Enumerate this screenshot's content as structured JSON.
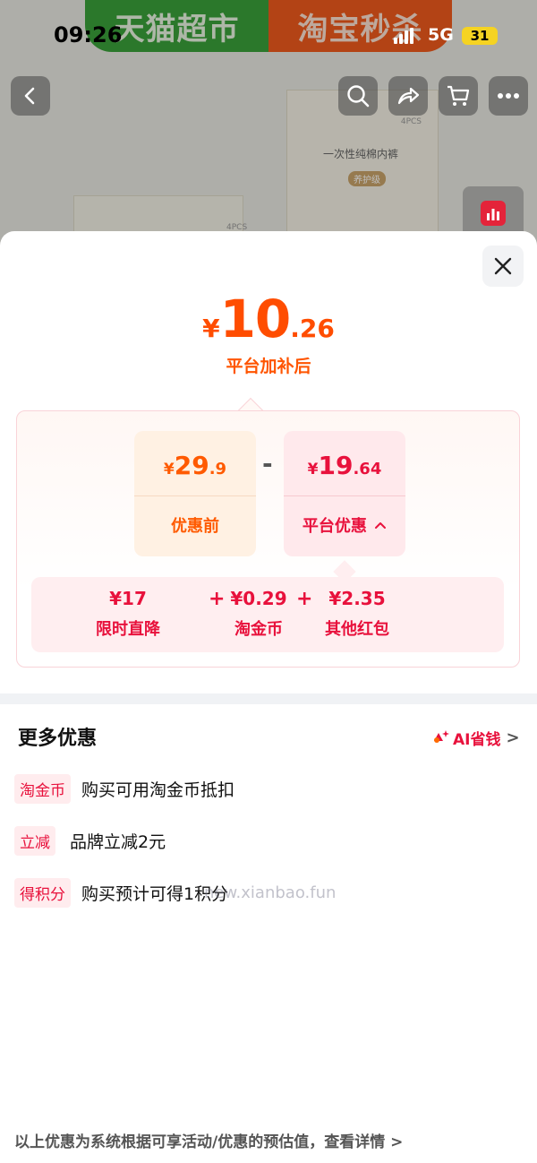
{
  "status_bar": {
    "time": "09:26",
    "network": "5G",
    "battery": "31"
  },
  "background": {
    "banner_left": "天猫超市",
    "banner_right": "淘宝秒杀",
    "product_text": "一次性纯棉内裤",
    "product_tag": "养护级",
    "pcs_label": "4PCS"
  },
  "nav": {
    "back_icon": "chevron-left-icon",
    "search_icon": "search-icon",
    "share_icon": "share-icon",
    "cart_icon": "cart-icon",
    "more_icon": "more-dots-icon"
  },
  "sheet": {
    "final_price": {
      "currency": "¥",
      "integer": "10",
      "decimal": ".26",
      "caption": "平台加补后"
    },
    "before": {
      "currency": "¥",
      "integer": "29",
      "decimal": ".9",
      "label": "优惠前"
    },
    "operator": "-",
    "platform": {
      "currency": "¥",
      "integer": "19",
      "decimal": ".64",
      "label": "平台优惠",
      "chevron": "^"
    },
    "sub_discounts": [
      {
        "value": "¥17",
        "label": "限时直降"
      },
      {
        "value": "¥0.29",
        "label": "淘金币"
      },
      {
        "value": "¥2.35",
        "label": "其他红包"
      }
    ],
    "plus_symbol": "+",
    "more_section": {
      "title": "更多优惠",
      "ai_link_label": "AI省钱",
      "ai_link_chevron": ">"
    },
    "promos": [
      {
        "tag": "淘金币",
        "text": "购买可用淘金币抵扣"
      },
      {
        "tag": "立减",
        "text": "品牌立减2元"
      },
      {
        "tag": "得积分",
        "text": "购买预计可得1积分"
      }
    ],
    "footer_note": "以上优惠为系统根据可享活动/优惠的预估值，查看详情 >",
    "watermark": "new.xianbao.fun"
  },
  "colors": {
    "accent_orange": "#ff4d00",
    "accent_red": "#e8113c",
    "battery_yellow": "#f5d322"
  }
}
